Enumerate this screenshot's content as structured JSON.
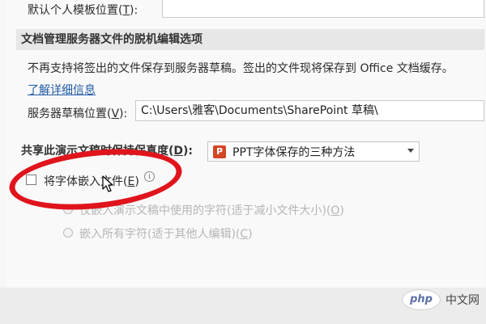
{
  "top_field": {
    "label": "默认个人模板位置(",
    "accesskey": "T",
    "label_suffix": "):"
  },
  "offline_section": {
    "header": "文档管理服务器文件的脱机编辑选项",
    "notice": "不再支持将签出的文件保存到服务器草稿。签出的文件现将保存到 Office 文档缓存。",
    "learn_more": "了解详细信息",
    "drafts_label": "服务器草稿位置(",
    "drafts_accesskey": "V",
    "drafts_label_suffix": "):",
    "drafts_value": "C:\\Users\\雅客\\Documents\\SharePoint 草稿\\"
  },
  "fidelity_section": {
    "header_prefix": "共享此演示文稿时保持保真度(",
    "header_accesskey": "D",
    "header_suffix": "):",
    "presentation_icon": "ppt-file-icon",
    "presentation_name": "PPT字体保存的三种方法",
    "embed_fonts": {
      "label_prefix": "将字体嵌入文件(",
      "accesskey": "E",
      "label_suffix": ")",
      "checked": false
    },
    "embed_options": [
      {
        "label_prefix": "仅嵌入演示文稿中使用的字符(适于减小文件大小)(",
        "accesskey": "O",
        "label_suffix": ")"
      },
      {
        "label_prefix": "嵌入所有字符(适于其他人编辑)(",
        "accesskey": "C",
        "label_suffix": ")"
      }
    ]
  },
  "annotation": {
    "highlight_color": "#e0141c"
  },
  "watermark": {
    "logo_text": "php",
    "site_text": "中文网"
  },
  "colors": {
    "link": "#1f5aa6",
    "section_header_bg": "#e7e7e7",
    "disabled_text": "#b5b5b5",
    "ppt_icon": "#d24726"
  }
}
